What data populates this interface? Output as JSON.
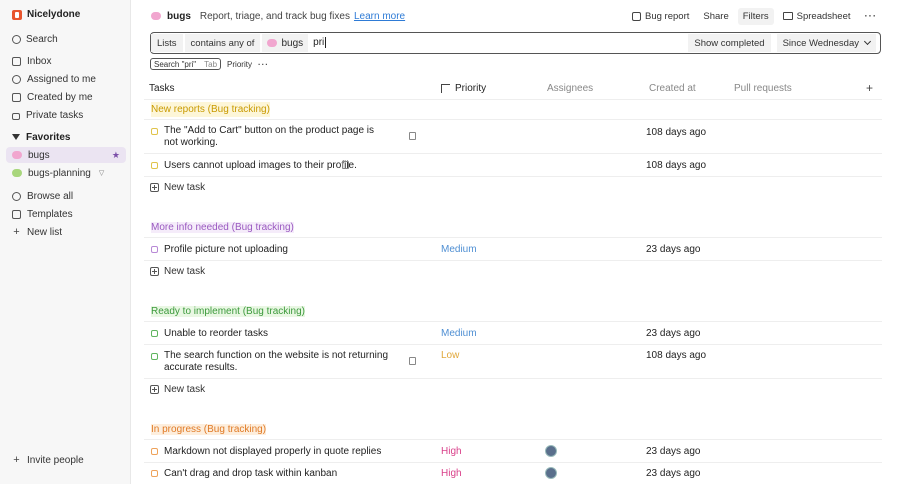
{
  "workspace": {
    "name": "Nicelydone"
  },
  "sidebar": {
    "search_label": "Search",
    "items": [
      {
        "label": "Inbox",
        "icon": "inbox-icon"
      },
      {
        "label": "Assigned to me",
        "icon": "person-icon"
      },
      {
        "label": "Created by me",
        "icon": "calendar-icon"
      },
      {
        "label": "Private tasks",
        "icon": "lock-icon"
      }
    ],
    "favorites_label": "Favorites",
    "favorites": [
      {
        "label": "bugs",
        "active": true
      },
      {
        "label": "bugs-planning"
      }
    ],
    "browse_all": "Browse all",
    "templates": "Templates",
    "new_list": "New list",
    "invite": "Invite people"
  },
  "header": {
    "title": "bugs",
    "description": "Report, triage, and track bug fixes",
    "learn_more": "Learn more",
    "bug_report": "Bug report",
    "share": "Share",
    "filters": "Filters",
    "spreadsheet": "Spreadsheet"
  },
  "filter": {
    "lists": "Lists",
    "operator": "contains any of",
    "chip": "bugs",
    "query": "pri",
    "show_completed": "Show completed",
    "since": "Since Wednesday"
  },
  "suggestions": {
    "search_label": "Search \"pri\"",
    "tab_key": "Tab",
    "priority": "Priority"
  },
  "table": {
    "columns": {
      "tasks": "Tasks",
      "priority": "Priority",
      "assignees": "Assignees",
      "created_at": "Created at",
      "pull_requests": "Pull requests"
    },
    "new_task_label": "New task",
    "groups": [
      {
        "label": "New reports (Bug tracking)",
        "tasks": [
          {
            "title": "The \"Add to Cart\" button on the product page is not working.",
            "priority": "",
            "created": "108 days ago"
          },
          {
            "title": "Users cannot upload images to their profile.",
            "priority": "",
            "created": "108 days ago"
          }
        ]
      },
      {
        "label": "More info needed (Bug tracking)",
        "tasks": [
          {
            "title": "Profile picture not uploading",
            "priority": "Medium",
            "created": "23 days ago"
          }
        ]
      },
      {
        "label": "Ready to implement (Bug tracking)",
        "tasks": [
          {
            "title": "Unable to reorder tasks",
            "priority": "Medium",
            "created": "23 days ago"
          },
          {
            "title": "The search function on the website is not returning accurate results.",
            "priority": "Low",
            "created": "108 days ago"
          }
        ]
      },
      {
        "label": "In progress (Bug tracking)",
        "tasks": [
          {
            "title": "Markdown not displayed properly in quote replies",
            "priority": "High",
            "created": "23 days ago"
          },
          {
            "title": "Can't drag and drop task within kanban",
            "priority": "High",
            "created": "23 days ago"
          }
        ]
      }
    ]
  },
  "colors": {
    "accent": "#e8552e",
    "active_nav": "#ebe4f2",
    "link": "#2e7bd6",
    "priority_medium": "#4f8fd3",
    "priority_low": "#e0a73a",
    "priority_high": "#d9408a"
  }
}
